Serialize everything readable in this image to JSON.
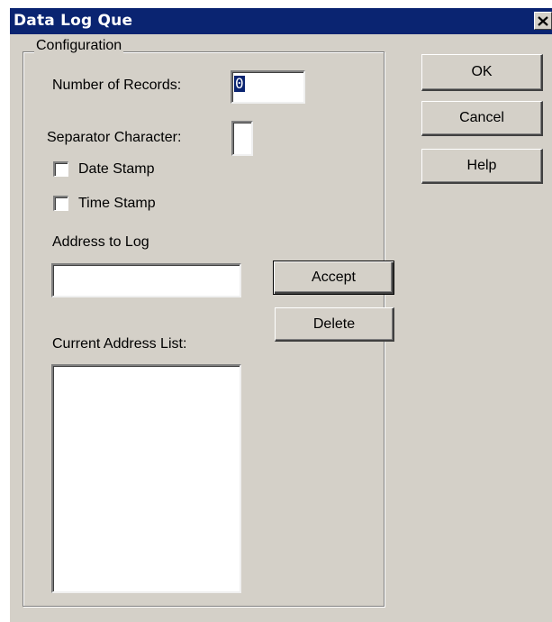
{
  "window": {
    "title": "Data Log Que"
  },
  "config": {
    "group_label": "Configuration",
    "num_records_label": "Number of Records:",
    "num_records_value": "0",
    "separator_label": "Separator Character:",
    "separator_value": "",
    "date_stamp_label": "Date Stamp",
    "date_stamp_checked": false,
    "time_stamp_label": "Time Stamp",
    "time_stamp_checked": false,
    "address_label": "Address to Log",
    "address_value": "",
    "current_list_label": "Current Address List:",
    "current_list_items": []
  },
  "buttons": {
    "ok": "OK",
    "cancel": "Cancel",
    "help": "Help",
    "accept": "Accept",
    "delete": "Delete"
  },
  "icons": {
    "close": "close-icon"
  },
  "colors": {
    "titlebar": "#0a2471",
    "face": "#d4d0c8"
  }
}
